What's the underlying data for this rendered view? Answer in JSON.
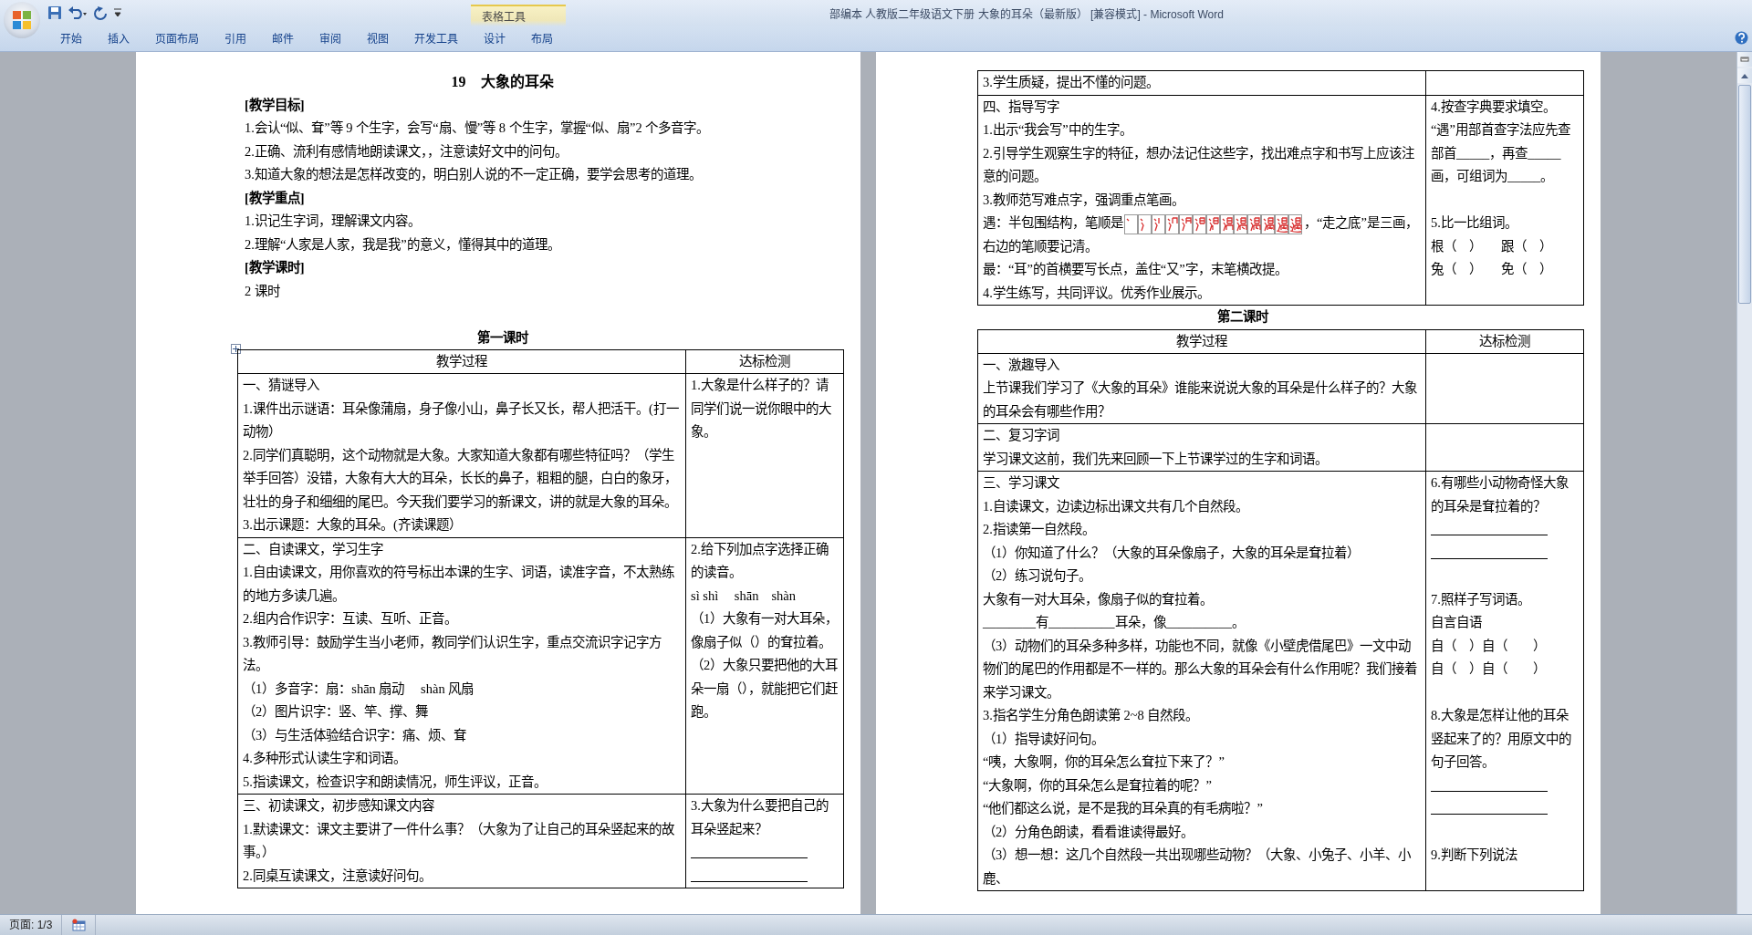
{
  "window": {
    "title": "部编本 人教版二年级语文下册 大象的耳朵（最新版） [兼容模式] - Microsoft Word"
  },
  "ribbon": {
    "tabs": [
      {
        "label": "开始"
      },
      {
        "label": "插入"
      },
      {
        "label": "页面布局"
      },
      {
        "label": "引用"
      },
      {
        "label": "邮件"
      },
      {
        "label": "审阅"
      },
      {
        "label": "视图"
      },
      {
        "label": "开发工具"
      }
    ],
    "contextual_group": {
      "label": "表格工具",
      "tabs": [
        {
          "label": "设计"
        },
        {
          "label": "布局"
        }
      ]
    }
  },
  "pages": [
    {
      "blocks": [
        {
          "kind": "title",
          "text": "19　大象的耳朵"
        },
        {
          "kind": "heading",
          "text": "[教学目标]"
        },
        {
          "kind": "para",
          "text": "1.会认“似、耷”等 9 个生字，会写“扇、慢”等 8 个生字，掌握“似、扇”2 个多音字。"
        },
        {
          "kind": "para",
          "text": "2.正确、流利有感情地朗读课文，，注意读好文中的问句。"
        },
        {
          "kind": "para",
          "text": "3.知道大象的想法是怎样改变的，明白别人说的不一定正确，要学会思考的道理。"
        },
        {
          "kind": "heading",
          "text": "[教学重点]"
        },
        {
          "kind": "para",
          "text": "1.识记生字词，理解课文内容。"
        },
        {
          "kind": "para",
          "text": "2.理解“人家是人家，我是我”的意义，懂得其中的道理。"
        },
        {
          "kind": "heading",
          "text": "[教学课时]"
        },
        {
          "kind": "para",
          "text": "2 课时"
        },
        {
          "kind": "blank"
        },
        {
          "kind": "section",
          "text": "第一课时"
        },
        {
          "kind": "table_handle"
        },
        {
          "kind": "table",
          "header": {
            "process": "教学过程",
            "check": "达标检测"
          },
          "rows": [
            {
              "process": [
                "一、猜谜导入",
                "1.课件出示谜语：耳朵像蒲扇，身子像小山，鼻子长又长，帮人把活干。(打一动物）",
                "2.同学们真聪明，这个动物就是大象。大家知道大象都有哪些特征吗？（学生举手回答）没错，大象有大大的耳朵，长长的鼻子，粗粗的腿，白白的象牙，壮壮的身子和细细的尾巴。今天我们要学习的新课文，讲的就是大象的耳朵。",
                "3.出示课题：大象的耳朵。(齐读课题）"
              ],
              "check": [
                "1.大象是什么样子的？请同学们说一说你眼中的大象。"
              ]
            },
            {
              "process": [
                "二、自读课文，学习生字",
                "1.自由读课文，用你喜欢的符号标出本课的生字、词语，读准字音，不太熟练的地方多读几遍。",
                "2.组内合作识字：互读、互听、正音。",
                "3.教师引导：鼓励学生当小老师，教同学们认识生字，重点交流识字记字方法。",
                "（1）多音字：扇：shān 扇动　 shàn 风扇",
                "（2）图片识字：竖、竿、撑、舞",
                "（3）与生活体验结合识字：痛、烦、耷",
                "4.多种形式认读生字和词语。",
                "5.指读课文，检查识字和朗读情况，师生评议，正音。"
              ],
              "check": [
                "2.给下列加点字选择正确的读音。",
                "sì shì　 shān　shàn",
                "（1）大象有一对大耳朵，像扇子似（）的耷拉着。",
                "（2）大象只要把他的大耳朵一扇（），就能把它们赶跑。"
              ]
            },
            {
              "process": [
                "三、初读课文，初步感知课文内容",
                "1.默读课文：课文主要讲了一件什么事？（大象为了让自己的耳朵竖起来的故事。）",
                "2.同桌互读课文，注意读好问句。"
              ],
              "check": [
                "3.大象为什么要把自己的耳朵竖起来？",
                {
                  "kind": "fill_line"
                },
                {
                  "kind": "fill_line"
                }
              ]
            }
          ]
        }
      ]
    },
    {
      "blocks": [
        {
          "kind": "table",
          "rows": [
            {
              "process": [
                "3.学生质疑，提出不懂的问题。"
              ]
            },
            {
              "process": [
                "四、指导写字",
                "1.出示“我会写”中的生字。",
                "2.引导学生观察生字的特征，想办法记住这些字，找出难点字和书写上应该注意的问题。",
                "3.教师范写难点字，强调重点笔画。",
                {
                  "kind": "stroke_order",
                  "before": "遇：半包围结构，笔顺是",
                  "after": "，“走之底”是三画，右边的笔顺要记清。"
                },
                "最：“耳”的首横要写长点，盖住“又”字，末笔横改提。",
                "4.学生练写，共同评议。优秀作业展示。"
              ],
              "check": [
                "4.按查字典要求填空。",
                "“遇”用部首查字法应先查部首_____，再查_____画，可组词为_____。",
                {
                  "kind": "blank"
                },
                "5.比一比组词。",
                "根（　）　　跟（　）",
                "兔（　）　　免（　）"
              ]
            }
          ]
        },
        {
          "kind": "section",
          "text": "第二课时"
        },
        {
          "kind": "table",
          "header": {
            "process": "教学过程",
            "check": "达标检测"
          },
          "rows": [
            {
              "process": [
                "一、激趣导入",
                "上节课我们学习了《大象的耳朵》谁能来说说大象的耳朵是什么样子的？大象的耳朵会有哪些作用？"
              ],
              "check": [
                {
                  "kind": "blank"
                }
              ]
            },
            {
              "process": [
                "二、复习字词",
                "学习课文这前，我们先来回顾一下上节课学过的生字和词语。"
              ],
              "check": [
                {
                  "kind": "blank"
                }
              ]
            },
            {
              "process": [
                "三、学习课文",
                "1.自读课文，边读边标出课文共有几个自然段。",
                "2.指读第一自然段。",
                "（1）你知道了什么？（大象的耳朵像扇子，大象的耳朵是耷拉着）",
                "（2）练习说句子。",
                "大象有一对大耳朵，像扇子似的耷拉着。",
                "________有__________耳朵，像__________。",
                "（3）动物们的耳朵多种多样，功能也不同，就像《小壁虎借尾巴》一文中动物们的尾巴的作用都是不一样的。那么大象的耳朵会有什么作用呢？我们接着来学习课文。",
                "3.指名学生分角色朗读第 2~8 自然段。",
                "（1）指导读好问句。",
                "“咦，大象啊，你的耳朵怎么耷拉下来了？”",
                "“大象啊，你的耳朵怎么是耷拉着的呢？”",
                "“他们都这么说，是不是我的耳朵真的有毛病啦？”",
                "（2）分角色朗读，看看谁读得最好。",
                "（3）想一想：这几个自然段一共出现哪些动物？（大象、小兔子、小羊、小鹿、"
              ],
              "check": [
                "6.有哪些小动物奇怪大象的耳朵是耷拉着的？",
                {
                  "kind": "fill_line"
                },
                {
                  "kind": "fill_line"
                },
                {
                  "kind": "blank"
                },
                "7.照样子写词语。",
                "自言自语",
                "自（　）自（　　）",
                "自（　）自（　　）",
                {
                  "kind": "blank"
                },
                "8.大象是怎样让他的耳朵竖起来了的？用原文中的句子回答。",
                {
                  "kind": "fill_line"
                },
                {
                  "kind": "fill_line"
                },
                {
                  "kind": "blank"
                },
                "9.判断下列说法"
              ]
            }
          ]
        }
      ]
    }
  ],
  "status_bar": {
    "page": "页面: 1/3"
  }
}
